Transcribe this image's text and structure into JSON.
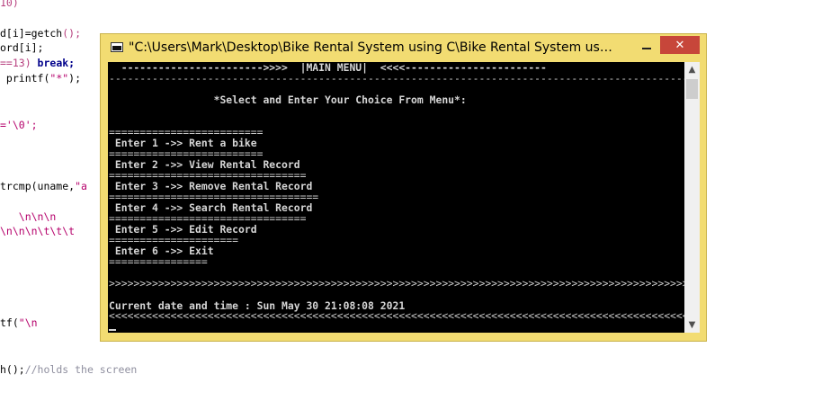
{
  "editor": {
    "lines": [
      {
        "parts": [
          {
            "t": "10)",
            "c": "c-paren"
          }
        ]
      },
      {
        "parts": [
          {
            "t": "d[i]=getch",
            "c": "c-plain"
          },
          {
            "t": "();",
            "c": "c-paren"
          }
        ]
      },
      {
        "parts": [
          {
            "t": "ord[i];",
            "c": "c-plain"
          }
        ]
      },
      {
        "parts": [
          {
            "t": "==13) ",
            "c": "c-num"
          },
          {
            "t": "break;",
            "c": "c-key"
          }
        ]
      },
      {
        "parts": [
          {
            "t": " printf(",
            "c": "c-plain"
          },
          {
            "t": "\"*\"",
            "c": "c-str"
          },
          {
            "t": ");",
            "c": "c-plain"
          }
        ]
      },
      {
        "parts": [
          {
            "t": "='\\0';",
            "c": "c-str"
          }
        ]
      },
      {
        "parts": [
          {
            "t": "trcmp(uname,",
            "c": "c-plain"
          },
          {
            "t": "\"a",
            "c": "c-str"
          }
        ]
      },
      {
        "parts": [
          {
            "t": "   \\n\\n\\n",
            "c": "c-str"
          }
        ]
      },
      {
        "parts": [
          {
            "t": "\\n\\n\\n\\t\\t\\t",
            "c": "c-str"
          }
        ]
      },
      {
        "parts": [
          {
            "t": "tf(",
            "c": "c-plain"
          },
          {
            "t": "\"\\n",
            "c": "c-str"
          }
        ]
      },
      {
        "parts": [
          {
            "t": "h();",
            "c": "c-plain"
          },
          {
            "t": "//holds the screen",
            "c": "c-com"
          }
        ]
      }
    ]
  },
  "window": {
    "title": "\"C:\\Users\\Mark\\Desktop\\Bike Rental System using C\\Bike Rental System using C...",
    "close_glyph": "✕",
    "scroll_up_glyph": "▲",
    "scroll_down_glyph": "▼"
  },
  "console": {
    "lines": [
      {
        "kind": "header",
        "text": "  ----------------------->>>>  |MAIN MENU|  <<<<-----------------------"
      },
      {
        "kind": "sep",
        "text": "---------------------------------------------------------------------------------------------------"
      },
      {
        "kind": "text",
        "text": ""
      },
      {
        "kind": "text",
        "text": "                 *Select and Enter Your Choice From Menu*:"
      },
      {
        "kind": "text",
        "text": ""
      },
      {
        "kind": "text",
        "text": ""
      },
      {
        "kind": "sep",
        "text": "========================="
      },
      {
        "kind": "text",
        "text": " Enter 1 ->> Rent a bike"
      },
      {
        "kind": "sep",
        "text": "========================="
      },
      {
        "kind": "text",
        "text": " Enter 2 ->> View Rental Record"
      },
      {
        "kind": "sep",
        "text": "================================"
      },
      {
        "kind": "text",
        "text": " Enter 3 ->> Remove Rental Record"
      },
      {
        "kind": "sep",
        "text": "=================================="
      },
      {
        "kind": "text",
        "text": " Enter 4 ->> Search Rental Record"
      },
      {
        "kind": "sep",
        "text": "================================"
      },
      {
        "kind": "text",
        "text": " Enter 5 ->> Edit Record"
      },
      {
        "kind": "sep",
        "text": "====================="
      },
      {
        "kind": "text",
        "text": " Enter 6 ->> Exit"
      },
      {
        "kind": "sep",
        "text": "================"
      },
      {
        "kind": "text",
        "text": ""
      },
      {
        "kind": "sep",
        "text": ">>>>>>>>>>>>>>>>>>>>>>>>>>>>>>>>>>>>>>>>>>>>>>>>>>>>>>>>>>>>>>>>>>>>>>>>>>>>>>>>>>>>>>>>>>>>>>"
      },
      {
        "kind": "text",
        "text": ""
      },
      {
        "kind": "text",
        "text": "Current date and time : Sun May 30 21:08:08 2021"
      },
      {
        "kind": "sep",
        "text": "<<<<<<<<<<<<<<<<<<<<<<<<<<<<<<<<<<<<<<<<<<<<<<<<<<<<<<<<<<<<<<<<<<<<<<<<<<<<<<<<<<<<<<<<<<<<<<<"
      }
    ]
  },
  "colors": {
    "window_frame": "#f2dc72",
    "close_button": "#c7463a",
    "console_bg": "#000000",
    "console_text": "#d6d6d6"
  }
}
